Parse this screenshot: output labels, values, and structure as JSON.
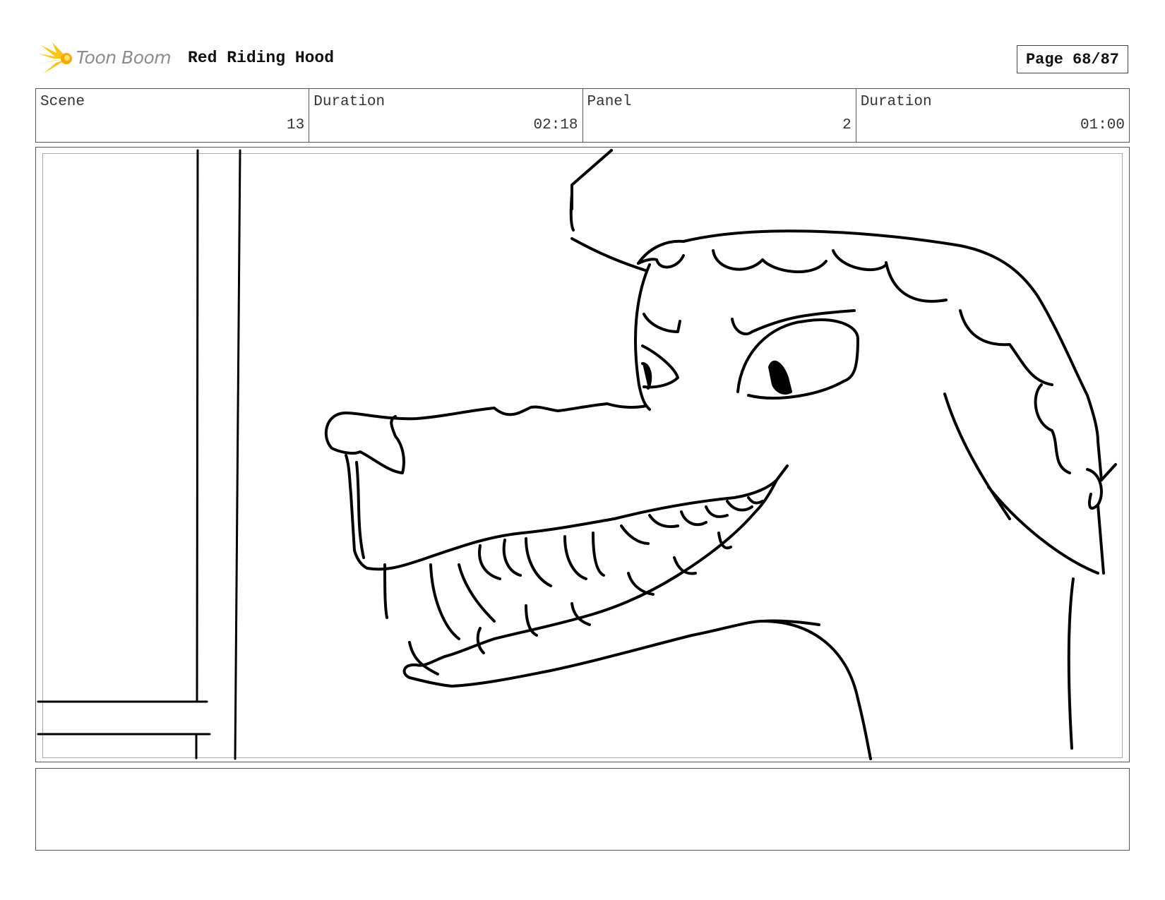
{
  "header": {
    "logo_text": "Toon Boom",
    "title": "Red Riding Hood",
    "page_label": "Page 68/87"
  },
  "info": {
    "scene_label": "Scene",
    "scene_value": "13",
    "scene_duration_label": "Duration",
    "scene_duration_value": "02:18",
    "panel_label": "Panel",
    "panel_value": "2",
    "panel_duration_label": "Duration",
    "panel_duration_value": "01:00"
  },
  "colors": {
    "logo_accent": "#f5c518",
    "logo_text": "#8c8c8c",
    "border": "#555555",
    "sketch_line": "#000000"
  },
  "icons": {
    "logo": "toon-boom-starburst-icon"
  },
  "notes": {
    "text": ""
  }
}
